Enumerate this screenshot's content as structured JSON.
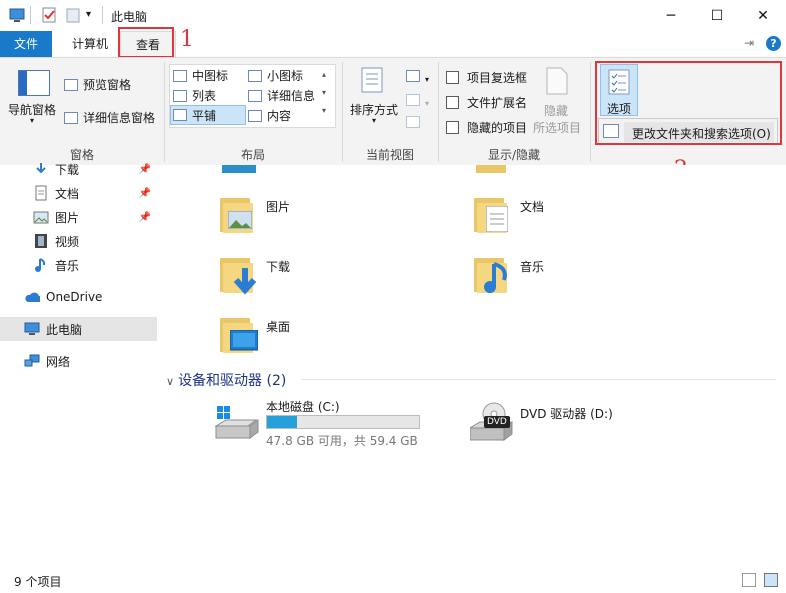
{
  "window": {
    "title": "此电脑",
    "minimize": "─",
    "maximize": "☐",
    "close": "✕"
  },
  "tabs": {
    "file": "文件",
    "computer": "计算机",
    "view": "查看"
  },
  "ribbon": {
    "pane": {
      "nav_pane": "导航窗格",
      "preview_pane": "预览窗格",
      "details_pane": "详细信息窗格",
      "group": "窗格"
    },
    "layout": {
      "medium_icons": "中图标",
      "small_icons": "小图标",
      "list": "列表",
      "details": "详细信息",
      "tiles": "平铺",
      "content": "内容",
      "group": "布局"
    },
    "current_view": {
      "sort_by": "排序方式",
      "group": "当前视图"
    },
    "show_hide": {
      "item_checkboxes": "项目复选框",
      "file_extensions": "文件扩展名",
      "hidden_items": "隐藏的项目",
      "hide_selected": "隐藏",
      "hide_selected_2": "所选项目",
      "group": "显示/隐藏"
    },
    "options": {
      "label": "选项",
      "change_folder_options": "更改文件夹和搜索选项(O)"
    }
  },
  "annotations": {
    "one": "1",
    "two": "2"
  },
  "nav": {
    "items": [
      {
        "label": "下载"
      },
      {
        "label": "文档"
      },
      {
        "label": "图片"
      },
      {
        "label": "视频"
      },
      {
        "label": "音乐"
      },
      {
        "label": "OneDrive"
      },
      {
        "label": "此电脑"
      },
      {
        "label": "网络"
      }
    ]
  },
  "folders": [
    {
      "name": "图片"
    },
    {
      "name": "文档"
    },
    {
      "name": "下载"
    },
    {
      "name": "音乐"
    },
    {
      "name": "桌面"
    }
  ],
  "devices": {
    "header": "设备和驱动器 (2)",
    "local_disk": {
      "name": "本地磁盘 (C:)",
      "usage_text": "47.8 GB 可用，共 59.4 GB",
      "used_fraction": 0.195
    },
    "dvd": {
      "name": "DVD 驱动器 (D:)",
      "badge": "DVD"
    }
  },
  "status": {
    "count": "9 个项目"
  },
  "colors": {
    "accent": "#1979ca",
    "highlight": "#e0353b",
    "selected_bg": "#cce4f7"
  }
}
